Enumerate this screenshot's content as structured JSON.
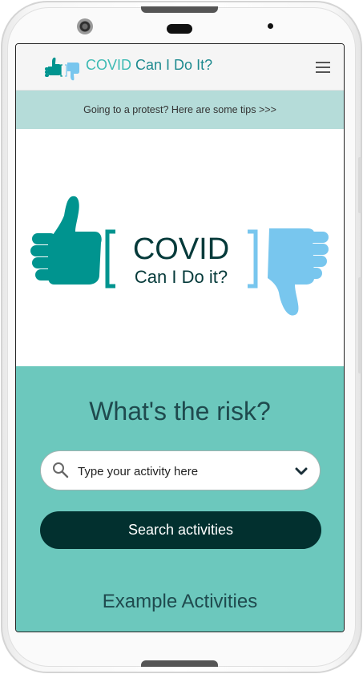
{
  "header": {
    "title_covid": "COVID",
    "title_rest": "Can I Do It?",
    "menu_icon": "hamburger-menu-icon"
  },
  "banner": {
    "text": "Going to a protest? Here are some tips >>>"
  },
  "hero": {
    "logo_line1": "COVID",
    "logo_line2": "Can I Do it?"
  },
  "main": {
    "heading": "What's the risk?",
    "search": {
      "placeholder": "Type your activity here",
      "value": ""
    },
    "search_button": "Search activities",
    "examples_heading": "Example Activities"
  },
  "colors": {
    "teal_dark": "#00948f",
    "teal_light": "#6cc8bd",
    "blue_thumb": "#78c6ee",
    "button_bg": "#02302f",
    "banner_bg": "#b5dcd9"
  }
}
